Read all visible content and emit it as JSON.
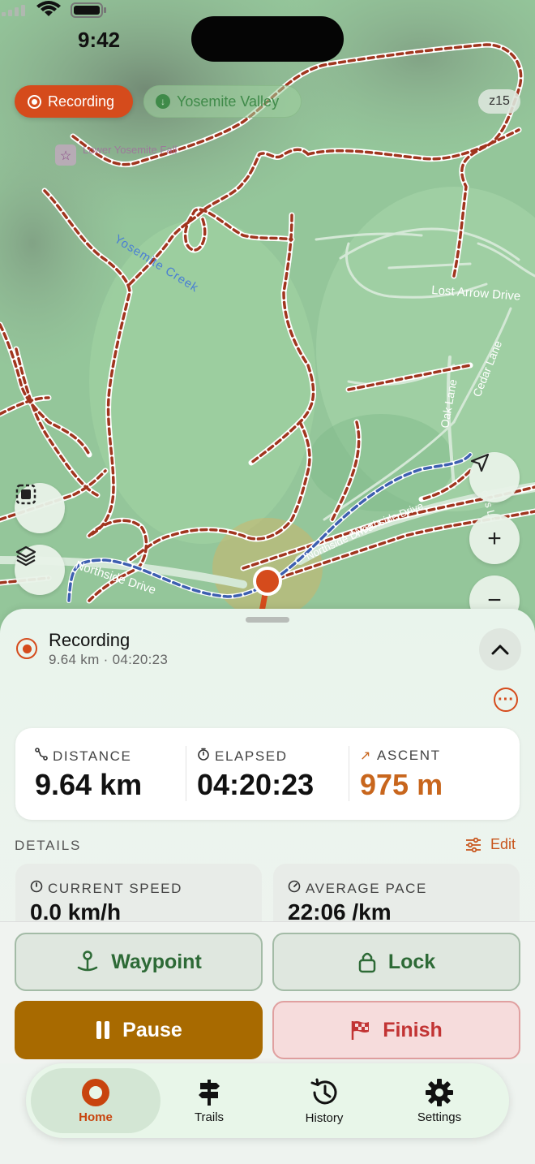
{
  "status_bar": {
    "time": "9:42"
  },
  "map": {
    "recording_pill": "Recording",
    "place_pill": "Yosemite Valley",
    "zoom_level": "z15",
    "labels": {
      "poi": "Lower Yosemite Fall",
      "creek": "Yosemite Creek",
      "lost_arrow": "Lost Arrow Drive",
      "oak_lane": "Oak Lane",
      "cedar_lane": "Cedar Lane",
      "northside_1": "Northside Drive",
      "northside_2": "Northside Drive",
      "northside_3": "Northside Drive",
      "side_road": "ck's Ln"
    },
    "colors": {
      "trail": "#a0351e",
      "track": "#3d5fb0",
      "position": "#d54b1c"
    },
    "icons": [
      "select-area-icon",
      "layers-icon",
      "locate-arrow-icon",
      "plus-icon",
      "minus-icon"
    ]
  },
  "sheet": {
    "title": "Recording",
    "subtitle": "9.64 km · 04:20:23",
    "stats": [
      {
        "label": "DISTANCE",
        "value": "9.64 km",
        "icon": "route-icon"
      },
      {
        "label": "ELAPSED",
        "value": "04:20:23",
        "icon": "timer-icon"
      },
      {
        "label": "ASCENT",
        "value": "975 m",
        "icon": "ascent-arrow-icon"
      }
    ],
    "details_label": "DETAILS",
    "edit_label": "Edit",
    "details": [
      {
        "label": "CURRENT SPEED",
        "value": "0.0 km/h",
        "icon": "speedometer-icon"
      },
      {
        "label": "AVERAGE PACE",
        "value": "22:06 /km",
        "icon": "gauge-icon"
      }
    ]
  },
  "actions": {
    "waypoint": "Waypoint",
    "lock": "Lock",
    "pause": "Pause",
    "finish": "Finish"
  },
  "tabs": [
    {
      "label": "Home",
      "active": true
    },
    {
      "label": "Trails",
      "active": false
    },
    {
      "label": "History",
      "active": false
    },
    {
      "label": "Settings",
      "active": false
    }
  ]
}
